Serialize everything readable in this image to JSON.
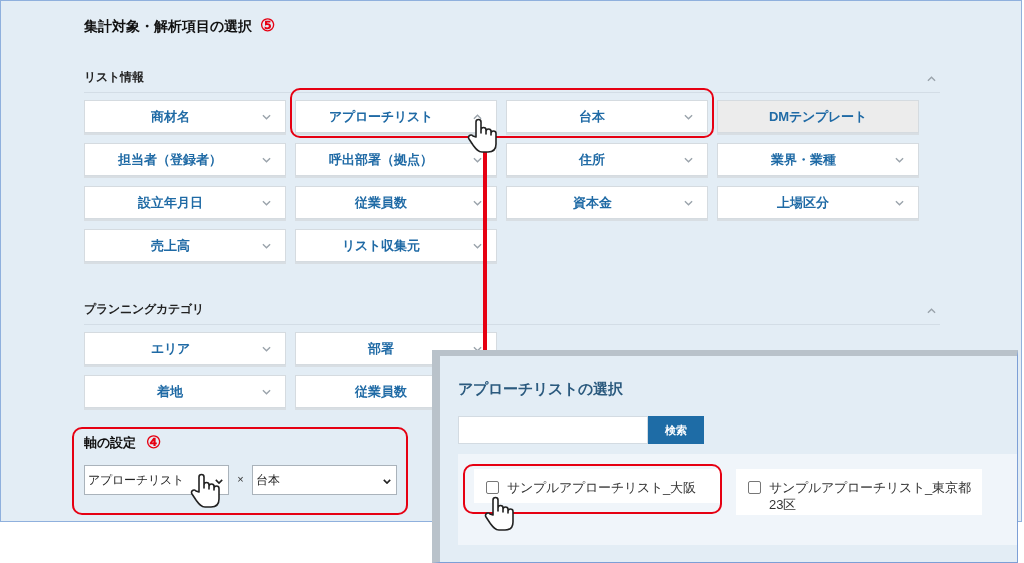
{
  "page": {
    "title": "集計対象・解析項目の選択",
    "step": "⑤"
  },
  "sections": [
    {
      "title": "リスト情報",
      "expanded": true,
      "items": [
        {
          "label": "商材名",
          "kind": "dropdown",
          "expanded": false
        },
        {
          "label": "アプローチリスト",
          "kind": "dropdown",
          "expanded": true
        },
        {
          "label": "台本",
          "kind": "dropdown",
          "expanded": false
        },
        {
          "label": "DMテンプレート",
          "kind": "plain"
        },
        {
          "label": "担当者（登録者）",
          "kind": "dropdown",
          "expanded": false
        },
        {
          "label": "呼出部署（拠点）",
          "kind": "dropdown",
          "expanded": false
        },
        {
          "label": "住所",
          "kind": "dropdown",
          "expanded": false
        },
        {
          "label": "業界・業種",
          "kind": "dropdown",
          "expanded": false
        },
        {
          "label": "設立年月日",
          "kind": "dropdown",
          "expanded": false
        },
        {
          "label": "従業員数",
          "kind": "dropdown",
          "expanded": false
        },
        {
          "label": "資本金",
          "kind": "dropdown",
          "expanded": false
        },
        {
          "label": "上場区分",
          "kind": "dropdown",
          "expanded": false
        },
        {
          "label": "売上高",
          "kind": "dropdown",
          "expanded": false
        },
        {
          "label": "リスト収集元",
          "kind": "dropdown",
          "expanded": false
        }
      ]
    },
    {
      "title": "プランニングカテゴリ",
      "expanded": true,
      "items": [
        {
          "label": "エリア",
          "kind": "dropdown",
          "expanded": false
        },
        {
          "label": "部署",
          "kind": "dropdown",
          "expanded": false
        },
        {
          "label": "着地",
          "kind": "dropdown",
          "expanded": false
        },
        {
          "label": "従業員数",
          "kind": "dropdown"
        }
      ]
    }
  ],
  "axis": {
    "title": "軸の設定",
    "step": "④",
    "separator": "×",
    "selects": [
      {
        "value": "アプローチリスト"
      },
      {
        "value": "台本"
      }
    ]
  },
  "dialog": {
    "title": "アプローチリストの選択",
    "search_button": "検索",
    "options": [
      {
        "label": "サンプルアプローチリスト_大阪",
        "checked": false
      },
      {
        "label": "サンプルアプローチリスト_東京都23区",
        "checked": false
      }
    ]
  }
}
